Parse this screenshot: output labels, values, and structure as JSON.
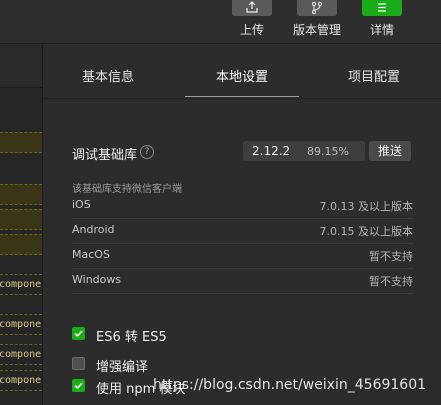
{
  "toolbar": {
    "upload": {
      "label": "上传",
      "icon": "upload-icon"
    },
    "version": {
      "label": "版本管理",
      "icon": "branch-icon"
    },
    "details": {
      "label": "详情",
      "icon": "menu-icon"
    }
  },
  "editor": {
    "code_snippet": "compone"
  },
  "tabs": [
    {
      "label": "基本信息"
    },
    {
      "label": "本地设置",
      "active": true
    },
    {
      "label": "项目配置"
    }
  ],
  "debug_lib": {
    "label": "调试基础库",
    "help": "?",
    "version": "2.12.2",
    "percent": "89.15%",
    "push_label": "推送",
    "support_text": "该基础库支持微信客户端"
  },
  "platforms": [
    {
      "name": "iOS",
      "value": "7.0.13 及以上版本"
    },
    {
      "name": "Android",
      "value": "7.0.15 及以上版本"
    },
    {
      "name": "MacOS",
      "value": "暂不支持"
    },
    {
      "name": "Windows",
      "value": "暂不支持"
    }
  ],
  "options": [
    {
      "label": "ES6 转 ES5",
      "checked": true
    },
    {
      "label": "增强编译",
      "checked": false
    },
    {
      "label": "使用 npm 模块",
      "checked": true
    }
  ],
  "watermark": "https://blog.csdn.net/weixin_45691601",
  "colors": {
    "accent": "#1aad19",
    "background": "#2c2c2c"
  }
}
